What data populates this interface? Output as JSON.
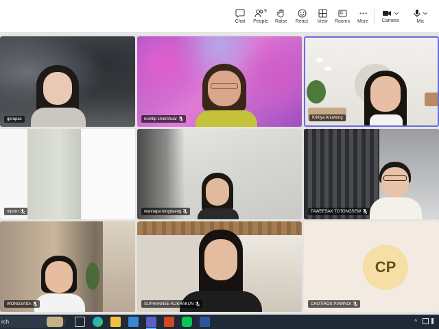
{
  "toolbar": {
    "chat": "Chat",
    "people": "People",
    "people_count": "9",
    "raise": "Raise",
    "react": "React",
    "view": "View",
    "rooms": "Rooms",
    "more": "More",
    "camera": "Camera",
    "mic": "Mic"
  },
  "participants": [
    {
      "name": "gprapas"
    },
    {
      "name": "numtip smerchuar"
    },
    {
      "name": "Krittiya Anuwong"
    },
    {
      "name": "mporn"
    },
    {
      "name": "wannapa tongdaeng"
    },
    {
      "name": "TAWEESAK TOTONGSEW"
    },
    {
      "name": "WONGSASA"
    },
    {
      "name": "SUPHANNEE KUKHAKUN"
    },
    {
      "name": "CHOTIROS PIAMNOI",
      "initials": "CP"
    }
  ],
  "taskbar": {
    "search": "rch"
  }
}
